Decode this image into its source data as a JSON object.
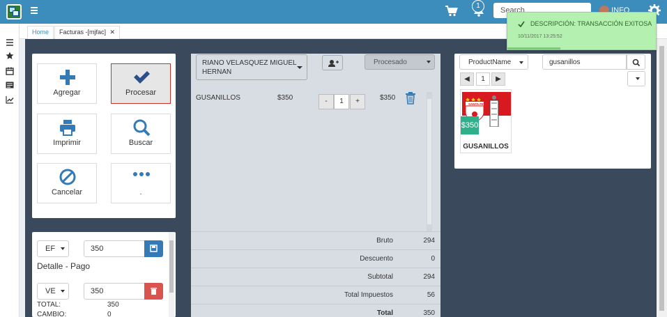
{
  "topbar": {
    "search_placeholder": "Search",
    "notifications_count": "1",
    "user_label": "INFO"
  },
  "tabs": [
    {
      "label": "Home"
    },
    {
      "label": "Facturas -[mjfac]"
    }
  ],
  "actions": [
    {
      "label": "Agregar",
      "icon": "plus-icon"
    },
    {
      "label": "Procesar",
      "icon": "check-icon"
    },
    {
      "label": "Imprimir",
      "icon": "print-icon"
    },
    {
      "label": "Buscar",
      "icon": "search-icon"
    },
    {
      "label": "Cancelar",
      "icon": "ban-icon"
    },
    {
      "label": ".",
      "icon": "ellipsis-icon"
    }
  ],
  "payment": {
    "method1": "EF",
    "amount1": "350",
    "title": "Detalle - Pago",
    "method2": "VE",
    "amount2": "350",
    "total_label": "TOTAL:",
    "total_value": "350",
    "change_label": "CAMBIO:",
    "change_value": "0"
  },
  "order": {
    "customer": "RIANO VELASQUEZ MIGUEL HERNAN",
    "status": "Procesado",
    "items": [
      {
        "name": "GUSANILLOS",
        "unit_price": "$350",
        "qty": "1",
        "total": "$350"
      }
    ],
    "totals": [
      {
        "label": "Bruto",
        "value": "294"
      },
      {
        "label": "Descuento",
        "value": "0"
      },
      {
        "label": "Subtotal",
        "value": "294"
      },
      {
        "label": "Total Impuestos",
        "value": "56"
      },
      {
        "label": "Total",
        "value": "350"
      }
    ]
  },
  "products": {
    "field": "ProductName",
    "query": "gusanillos",
    "page": "1",
    "cards": [
      {
        "name": "GUSANILLOS",
        "price": "$350",
        "brand": "SANTA FE"
      }
    ]
  },
  "toast": {
    "message": "DESCRIPCIÓN: TRANSACCIÓN EXITOSA",
    "timestamp": "10/11/2017 13:25:52"
  },
  "colors": {
    "topbar": "#3c8dbc",
    "main_bg": "#3a4a5c",
    "primary": "#337ab7",
    "danger": "#d9534f",
    "success_toast": "#b4f0b0",
    "price_badge": "#2fb08a"
  }
}
